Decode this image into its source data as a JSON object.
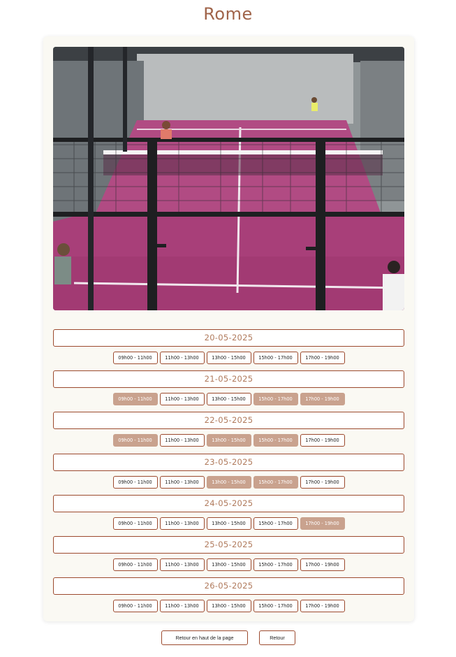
{
  "page": {
    "title": "Rome"
  },
  "photo": {
    "alt": "court-photo"
  },
  "days": [
    {
      "date": "20-05-2025",
      "slots": [
        {
          "label": "09h00 - 11h00",
          "booked": false
        },
        {
          "label": "11h00 - 13h00",
          "booked": false
        },
        {
          "label": "13h00 - 15h00",
          "booked": false
        },
        {
          "label": "15h00 - 17h00",
          "booked": false
        },
        {
          "label": "17h00 - 19h00",
          "booked": false
        }
      ]
    },
    {
      "date": "21-05-2025",
      "slots": [
        {
          "label": "09h00 - 11h00",
          "booked": true
        },
        {
          "label": "11h00 - 13h00",
          "booked": false
        },
        {
          "label": "13h00 - 15h00",
          "booked": false
        },
        {
          "label": "15h00 - 17h00",
          "booked": true
        },
        {
          "label": "17h00 - 19h00",
          "booked": true
        }
      ]
    },
    {
      "date": "22-05-2025",
      "slots": [
        {
          "label": "09h00 - 11h00",
          "booked": true
        },
        {
          "label": "11h00 - 13h00",
          "booked": false
        },
        {
          "label": "13h00 - 15h00",
          "booked": true
        },
        {
          "label": "15h00 - 17h00",
          "booked": true
        },
        {
          "label": "17h00 - 19h00",
          "booked": false
        }
      ]
    },
    {
      "date": "23-05-2025",
      "slots": [
        {
          "label": "09h00 - 11h00",
          "booked": false
        },
        {
          "label": "11h00 - 13h00",
          "booked": false
        },
        {
          "label": "13h00 - 15h00",
          "booked": true
        },
        {
          "label": "15h00 - 17h00",
          "booked": true
        },
        {
          "label": "17h00 - 19h00",
          "booked": false
        }
      ]
    },
    {
      "date": "24-05-2025",
      "slots": [
        {
          "label": "09h00 - 11h00",
          "booked": false
        },
        {
          "label": "11h00 - 13h00",
          "booked": false
        },
        {
          "label": "13h00 - 15h00",
          "booked": false
        },
        {
          "label": "15h00 - 17h00",
          "booked": false
        },
        {
          "label": "17h00 - 19h00",
          "booked": true
        }
      ]
    },
    {
      "date": "25-05-2025",
      "slots": [
        {
          "label": "09h00 - 11h00",
          "booked": false
        },
        {
          "label": "11h00 - 13h00",
          "booked": false
        },
        {
          "label": "13h00 - 15h00",
          "booked": false
        },
        {
          "label": "15h00 - 17h00",
          "booked": false
        },
        {
          "label": "17h00 - 19h00",
          "booked": false
        }
      ]
    },
    {
      "date": "26-05-2025",
      "slots": [
        {
          "label": "09h00 - 11h00",
          "booked": false
        },
        {
          "label": "11h00 - 13h00",
          "booked": false
        },
        {
          "label": "13h00 - 15h00",
          "booked": false
        },
        {
          "label": "15h00 - 17h00",
          "booked": false
        },
        {
          "label": "17h00 - 19h00",
          "booked": false
        }
      ]
    }
  ],
  "footer": {
    "top_label": "Retour en haut de la page",
    "back_label": "Retour"
  },
  "colors": {
    "accent": "#9c4a2e",
    "booked": "#c9a28e",
    "title": "#a0644a",
    "court": "#b54a86"
  }
}
